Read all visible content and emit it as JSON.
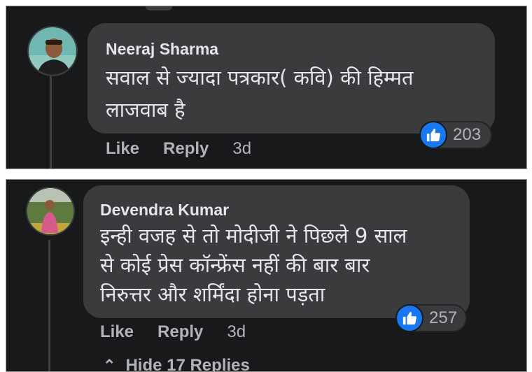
{
  "comments": [
    {
      "author": "Neeraj Sharma",
      "text_line1": "सवाल से ज्यादा पत्रकार( कवि) की हिम्मत",
      "text_line2": "लाजवाब है",
      "reaction_icon": "thumbs-up-icon",
      "reaction_count": "203",
      "like_label": "Like",
      "reply_label": "Reply",
      "time": "3d"
    },
    {
      "author": "Devendra Kumar",
      "text_line1": "इन्ही वजह से तो मोदीजी ने पिछले 9 साल",
      "text_line2": "से कोई प्रेस कॉन्फ्रेंस नहीं की बार बार",
      "text_line3": "निरुत्तर और शर्मिंदा होना पड़ता",
      "reaction_icon": "thumbs-up-icon",
      "reaction_count": "257",
      "like_label": "Like",
      "reply_label": "Reply",
      "time": "3d"
    }
  ],
  "hide_replies_label": "Hide 17 Replies",
  "colors": {
    "background": "#18191a",
    "bubble": "#3a3b3c",
    "text": "#e4e6eb",
    "secondary_text": "#b0b3b8",
    "like_blue": "#1877f2"
  }
}
